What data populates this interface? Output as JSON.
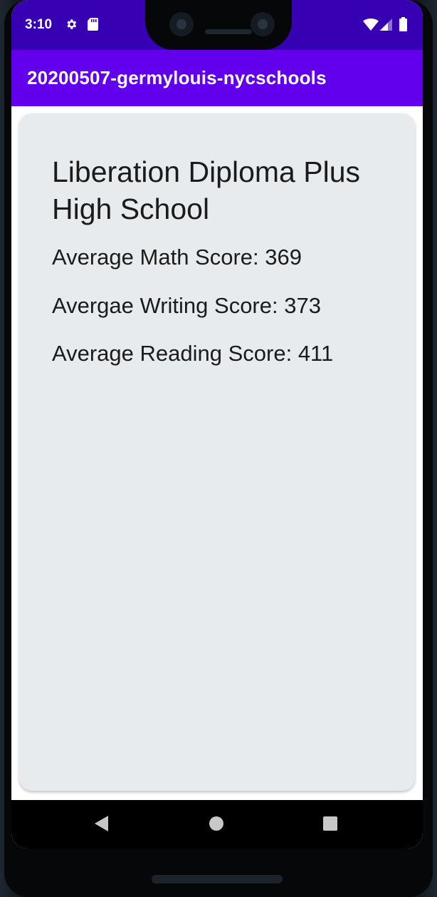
{
  "status_bar": {
    "time": "3:10",
    "icons": [
      "gear-icon",
      "sd-card-icon",
      "wifi-icon",
      "signal-icon",
      "battery-icon"
    ]
  },
  "app_bar": {
    "title": "20200507-germylouis-nycschools"
  },
  "school": {
    "name": "Liberation Diploma Plus High School",
    "math_score_text": "Average Math Score: 369",
    "writing_score_text": "Avergae Writing Score: 373",
    "reading_score_text": "Average Reading Score: 411"
  },
  "nav_bar": {
    "icons": [
      "back-icon",
      "home-icon",
      "recents-icon"
    ]
  },
  "colors": {
    "status_bar": "#3700b3",
    "app_bar": "#6200ee",
    "card": "#e8ebee",
    "text": "#1b1b1b"
  }
}
